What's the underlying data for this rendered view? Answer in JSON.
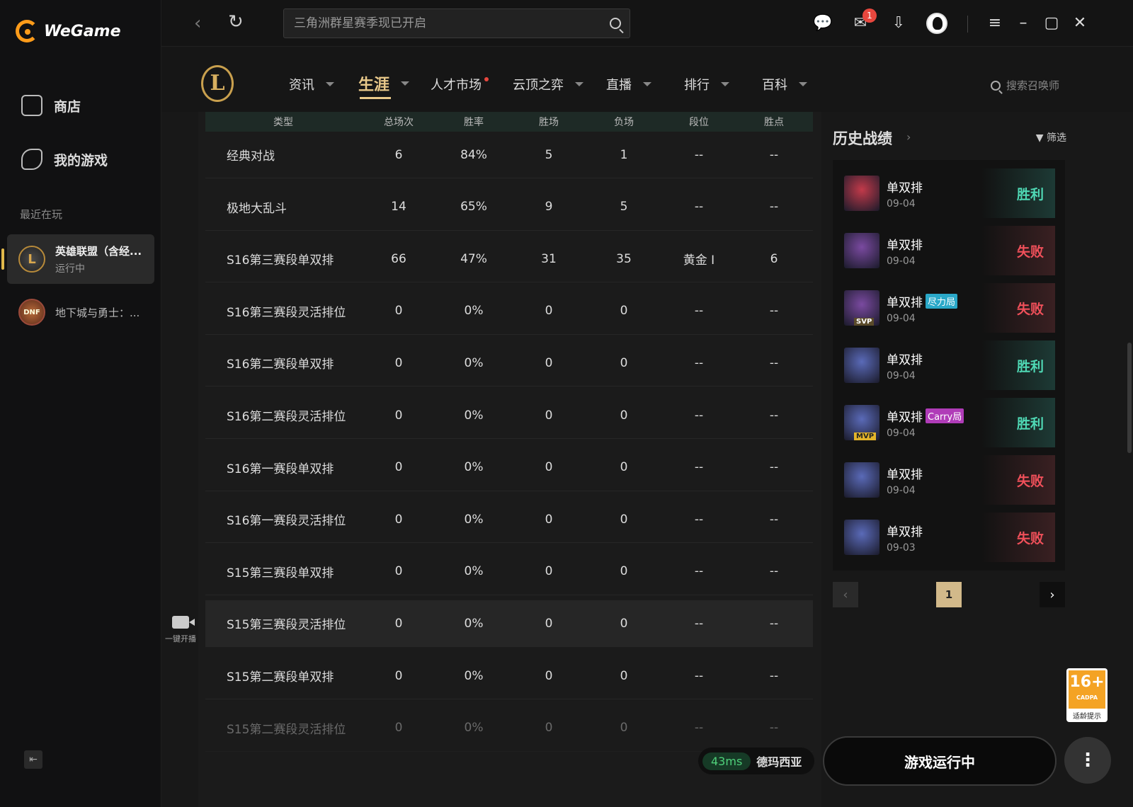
{
  "app": {
    "brand": "WeGame"
  },
  "sidebar": {
    "shop": "商店",
    "my_games": "我的游戏",
    "recent_title": "最近在玩",
    "recent": [
      {
        "name": "英雄联盟（含经...",
        "status": "运行中"
      },
      {
        "name": "地下城与勇士：..."
      }
    ]
  },
  "topbar": {
    "search_placeholder": "三角洲群星赛季现已开启",
    "mail_badge": "1"
  },
  "gamenav": {
    "items": [
      "资讯",
      "生涯",
      "人才市场",
      "云顶之弈",
      "直播",
      "排行",
      "百科"
    ],
    "summoner_search": "搜索召唤师"
  },
  "stats": {
    "headers": [
      "类型",
      "总场次",
      "胜率",
      "胜场",
      "负场",
      "段位",
      "胜点"
    ],
    "rows": [
      [
        "经典对战",
        "6",
        "84%",
        "5",
        "1",
        "--",
        "--"
      ],
      [
        "极地大乱斗",
        "14",
        "65%",
        "9",
        "5",
        "--",
        "--"
      ],
      [
        "S16第三赛段单双排",
        "66",
        "47%",
        "31",
        "35",
        "黄金 Ⅰ",
        "6"
      ],
      [
        "S16第三赛段灵活排位",
        "0",
        "0%",
        "0",
        "0",
        "--",
        "--"
      ],
      [
        "S16第二赛段单双排",
        "0",
        "0%",
        "0",
        "0",
        "--",
        "--"
      ],
      [
        "S16第二赛段灵活排位",
        "0",
        "0%",
        "0",
        "0",
        "--",
        "--"
      ],
      [
        "S16第一赛段单双排",
        "0",
        "0%",
        "0",
        "0",
        "--",
        "--"
      ],
      [
        "S16第一赛段灵活排位",
        "0",
        "0%",
        "0",
        "0",
        "--",
        "--"
      ],
      [
        "S15第三赛段单双排",
        "0",
        "0%",
        "0",
        "0",
        "--",
        "--"
      ],
      [
        "S15第三赛段灵活排位",
        "0",
        "0%",
        "0",
        "0",
        "--",
        "--"
      ],
      [
        "S15第二赛段单双排",
        "0",
        "0%",
        "0",
        "0",
        "--",
        "--"
      ],
      [
        "S15第二赛段灵活排位",
        "0",
        "0%",
        "0",
        "0",
        "--",
        "--"
      ]
    ],
    "live_label": "一键开播"
  },
  "history": {
    "title": "历史战绩",
    "filter": "筛选",
    "matches": [
      {
        "mode": "单双排",
        "date": "09-04",
        "result": "胜利",
        "win": true,
        "badge": "",
        "tag": "",
        "color": "#c23a4a"
      },
      {
        "mode": "单双排",
        "date": "09-04",
        "result": "失败",
        "win": false,
        "badge": "",
        "tag": "",
        "color": "#7a4aa0"
      },
      {
        "mode": "单双排",
        "date": "09-04",
        "result": "失败",
        "win": false,
        "badge": "尽力局",
        "badge_color": "#2aa8c8",
        "tag": "SVP",
        "color": "#7a4aa0"
      },
      {
        "mode": "单双排",
        "date": "09-04",
        "result": "胜利",
        "win": true,
        "badge": "",
        "tag": "",
        "color": "#5a6ab8"
      },
      {
        "mode": "单双排",
        "date": "09-04",
        "result": "胜利",
        "win": true,
        "badge": "Carry局",
        "badge_color": "#b03cb8",
        "tag": "MVP",
        "color": "#5a6ab8"
      },
      {
        "mode": "单双排",
        "date": "09-04",
        "result": "失败",
        "win": false,
        "badge": "",
        "tag": "",
        "color": "#5a6ab8"
      },
      {
        "mode": "单双排",
        "date": "09-03",
        "result": "失败",
        "win": false,
        "badge": "",
        "tag": "",
        "color": "#5a6ab8"
      }
    ],
    "page": "1"
  },
  "age_rating": {
    "age": "16+",
    "org": "CADPA",
    "label": "适龄提示"
  },
  "bottom": {
    "ping": "43ms",
    "region": "德玛西亚",
    "launch": "游戏运行中"
  }
}
